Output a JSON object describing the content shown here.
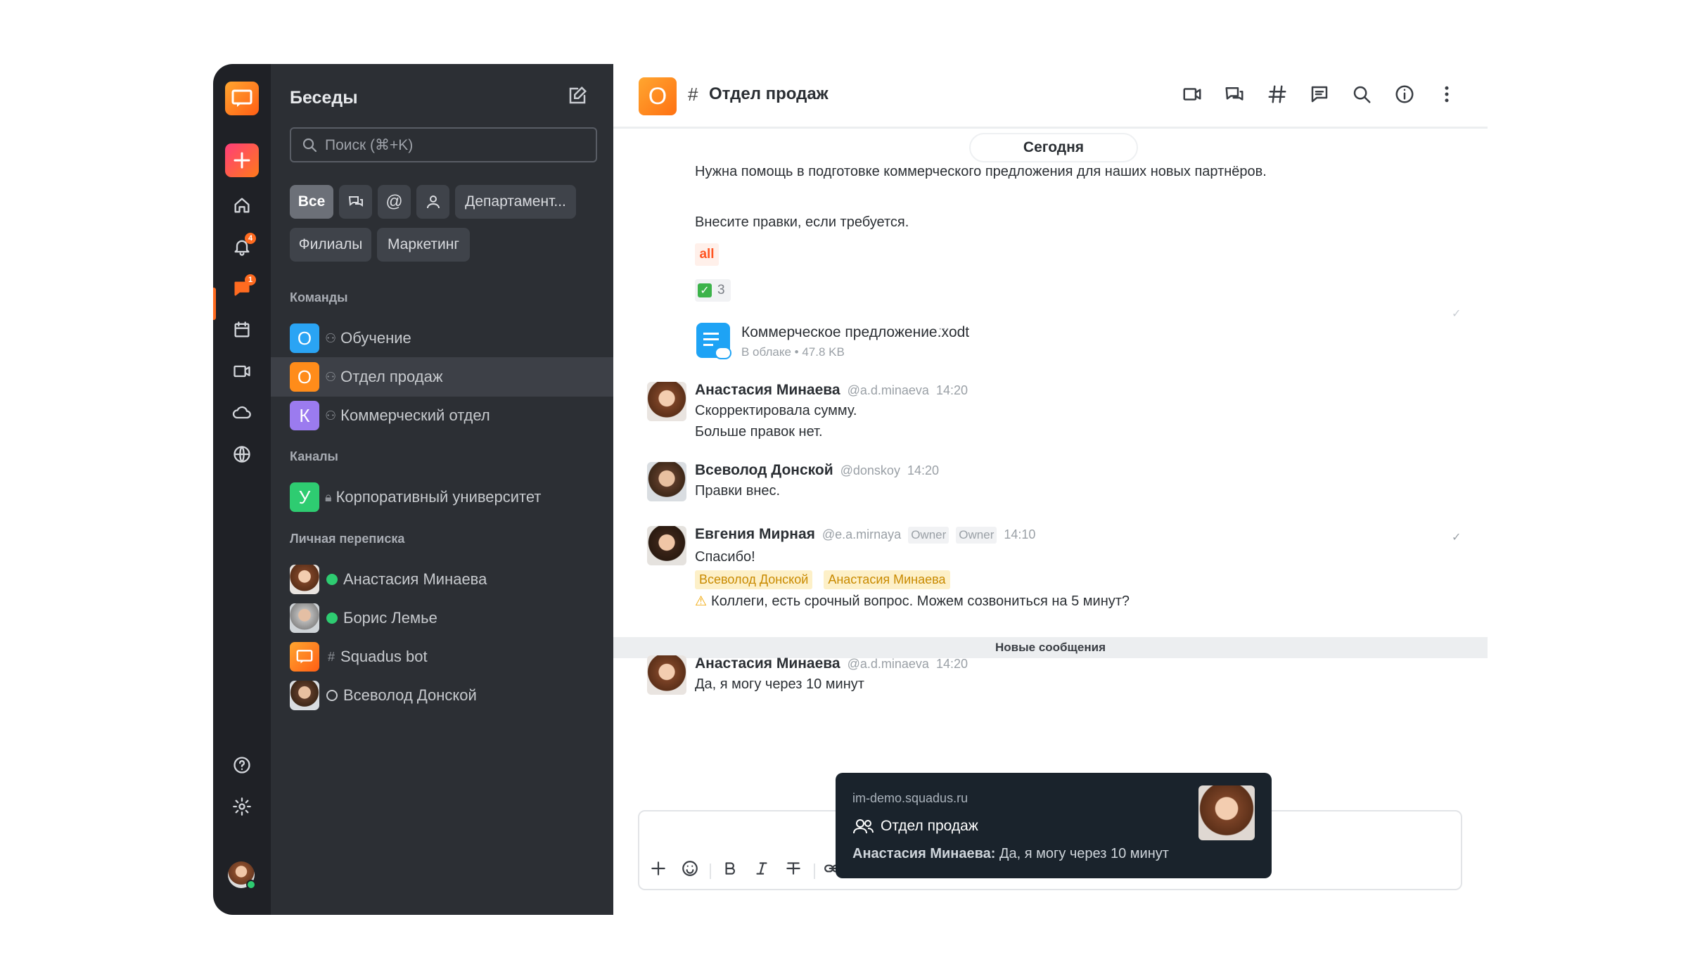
{
  "rail": {
    "items": [
      {
        "name": "home",
        "icon": "home-icon"
      },
      {
        "name": "notifications",
        "icon": "bell-icon",
        "badge": "4"
      },
      {
        "name": "chats",
        "icon": "chat-icon",
        "badge": "1"
      },
      {
        "name": "calendar",
        "icon": "calendar-icon"
      },
      {
        "name": "video",
        "icon": "video-icon"
      },
      {
        "name": "cloud",
        "icon": "cloud-icon"
      },
      {
        "name": "web",
        "icon": "globe-icon"
      }
    ],
    "help_icon": "help-icon",
    "settings_icon": "gear-icon"
  },
  "sidebar": {
    "title": "Беседы",
    "search_placeholder": "Поиск (⌘+K)",
    "filters": [
      "Все",
      "Департамент...",
      "Филиалы",
      "Маркетинг"
    ],
    "sections": {
      "teams": "Команды",
      "channels": "Каналы",
      "direct": "Личная переписка"
    },
    "teams": [
      {
        "initial": "О",
        "label": "Обучение",
        "color": "#2aa4f4"
      },
      {
        "initial": "О",
        "label": "Отдел продаж",
        "color": "#ff8c1a"
      },
      {
        "initial": "К",
        "label": "Коммерческий отдел",
        "color": "#9b7bef"
      }
    ],
    "channels": [
      {
        "initial": "У",
        "label": "Корпоративный университет",
        "color": "#2ecc71"
      }
    ],
    "direct": [
      {
        "label": "Анастасия Минаева"
      },
      {
        "label": "Борис Лемье"
      },
      {
        "label": "Squadus bot"
      },
      {
        "label": "Всеволод Донской"
      }
    ]
  },
  "header": {
    "initial": "О",
    "hash": "#",
    "title": "Отдел продаж"
  },
  "chat": {
    "today": "Сегодня",
    "intro1": "Нужна помощь в подготовке коммерческого предложения для наших новых партнёров.",
    "intro2": "Внесите правки, если требуется.",
    "all_tag": "all",
    "reaction_count": "3",
    "file": {
      "name": "Коммерческое предложение.xodt",
      "meta": "В облаке • 47.8 KB",
      "more": "···"
    },
    "messages": [
      {
        "user": "Анастасия Минаева",
        "handle": "@a.d.minaeva",
        "time": "14:20",
        "lines": [
          "Скорректировала сумму.",
          "Больше правок нет."
        ]
      },
      {
        "user": "Всеволод Донской",
        "handle": "@donskoy",
        "time": "14:20",
        "lines": [
          "Правки внес."
        ]
      },
      {
        "user": "Евгения Мирная",
        "handle": "@e.a.mirnaya",
        "owner": "Owner",
        "time": "14:10",
        "lines": [
          "Спасибо!"
        ],
        "mentions": [
          "Всеволод Донской",
          "Анастасия Минаева"
        ],
        "warn": "Коллеги, есть срочный вопрос. Можем созвониться на 5 минут?"
      }
    ],
    "new_divider": "Новые сообщения",
    "last": {
      "user": "Анастасия Минаева",
      "handle": "@a.d.minaeva",
      "time": "14:20",
      "text": "Да, я могу через 10 минут"
    }
  },
  "toast": {
    "domain": "im-demo.squadus.ru",
    "channel": "Отдел продаж",
    "sender": "Анастасия Минаева:",
    "text": " Да, я могу через 10 минут"
  }
}
